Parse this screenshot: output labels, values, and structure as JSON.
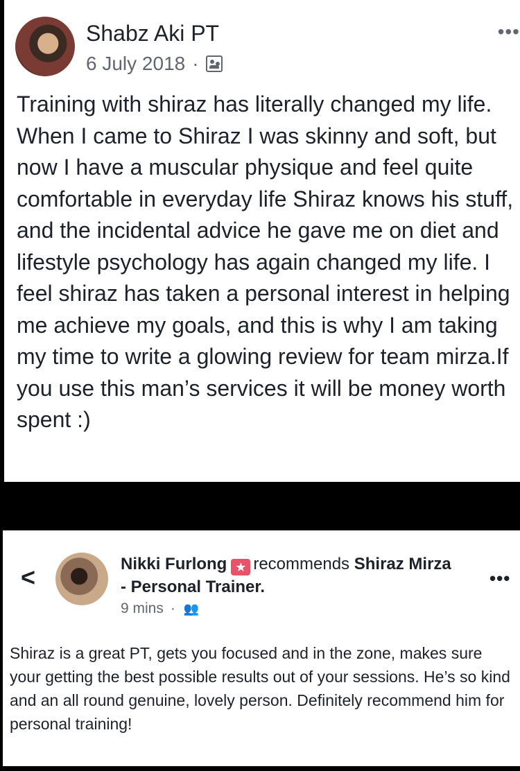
{
  "post1": {
    "author": "Shabz Aki PT",
    "date": "6 July 2018",
    "separator": "·",
    "audience_icon": "group-icon",
    "more_label": "•••",
    "text": "Training with shiraz has literally changed my life. When I came to Shiraz I was skinny and soft, but now I have a muscular physique and feel quite comfortable in everyday life Shiraz knows his stuff, and the incidental advice he gave me on diet and lifestyle psychology has again changed my life. I feel shiraz has taken a personal interest in helping me achieve my goals, and this is why I am taking my time to write a glowing review for team mirza.If you use this man’s services it will be money worth spent :)"
  },
  "post2": {
    "back_label": "<",
    "author": "Nikki Furlong",
    "badge_icon": "★",
    "recommends": "recommends",
    "page_name": "Shiraz Mirza - Personal Trainer.",
    "time": "9 mins",
    "separator": "·",
    "audience_icon": "friends-icon",
    "more_label": "•••",
    "text": "Shiraz is a great PT, gets you focused and in the zone, makes sure your getting the best possible results out of your sessions. He’s so kind and an all round genuine, lovely person. Definitely recommend him for personal training!"
  }
}
